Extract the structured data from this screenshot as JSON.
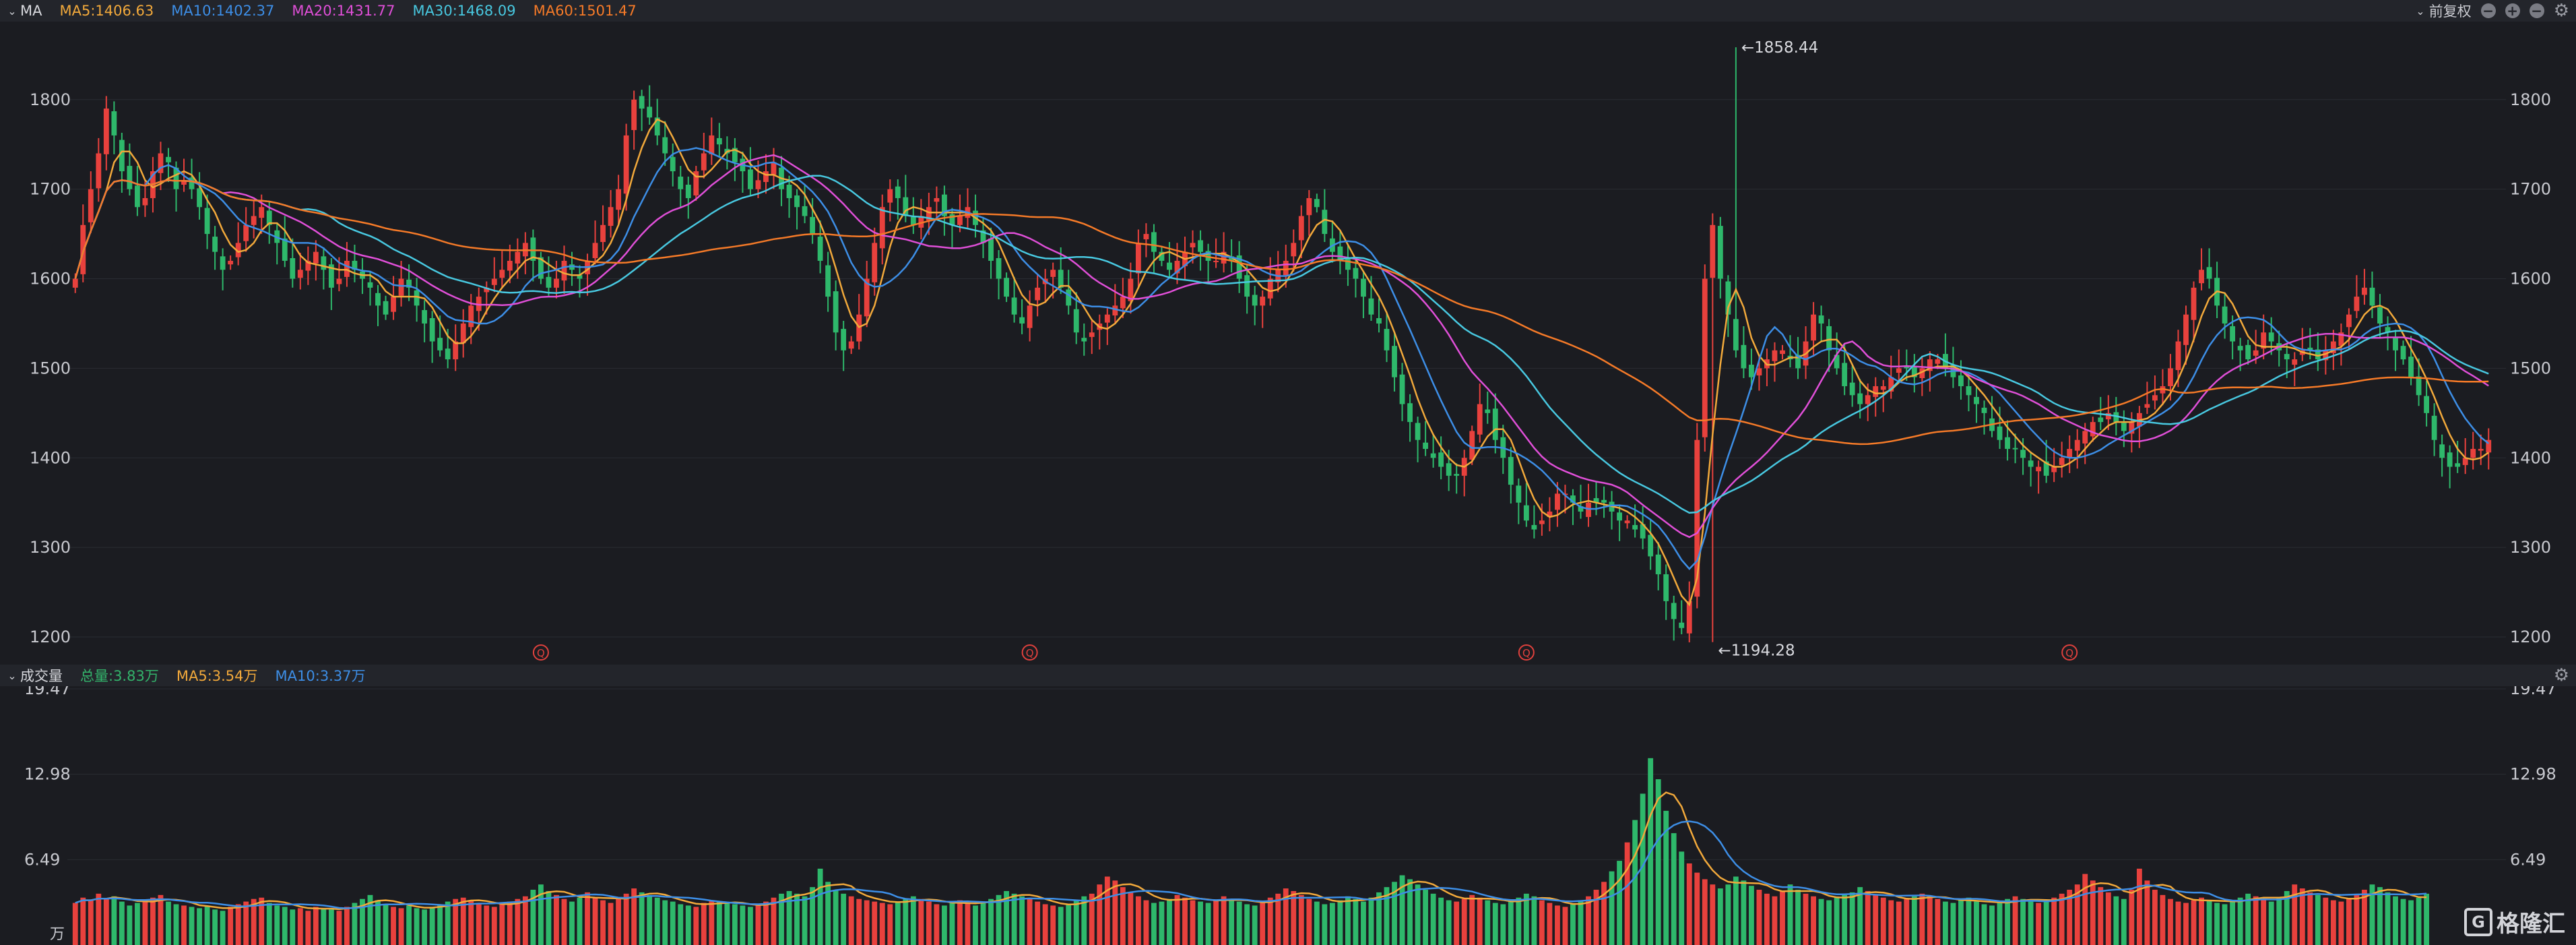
{
  "top_bar": {
    "indicator": "MA",
    "ma_readouts": [
      {
        "label": "MA5:1406.63",
        "color": "#f2a93b"
      },
      {
        "label": "MA10:1402.37",
        "color": "#3d8ee6"
      },
      {
        "label": "MA20:1431.77",
        "color": "#e04fd8"
      },
      {
        "label": "MA30:1468.09",
        "color": "#48c8e0"
      },
      {
        "label": "MA60:1501.47",
        "color": "#f57a28"
      }
    ],
    "adjust_label": "前复权"
  },
  "volume_bar": {
    "title": "成交量",
    "readouts": [
      {
        "label": "总量:3.83万",
        "color": "#33b46b"
      },
      {
        "label": "MA5:3.54万",
        "color": "#f2a93b"
      },
      {
        "label": "MA10:3.37万",
        "color": "#3d8ee6"
      }
    ]
  },
  "volume_unit": "万",
  "watermark": "格隆汇",
  "colors": {
    "up": "#e8413d",
    "down": "#2eb86b",
    "ma60": "#f57a28",
    "ma5": "#f2a93b",
    "ma10": "#3d8ee6",
    "ma20": "#e04fd8",
    "ma30": "#48c8e0"
  },
  "chart_data": {
    "type": "candlestick",
    "price_axis": {
      "ticks": [
        1200,
        1300,
        1400,
        1500,
        1600,
        1700,
        1800
      ],
      "labels": [
        "1200",
        "1300",
        "1400",
        "1500",
        "1600",
        "1700",
        "1800"
      ]
    },
    "price_annotations": {
      "high": {
        "value": 1858.44,
        "label": "←1858.44"
      },
      "low": {
        "value": 1194.28,
        "label": "←1194.28"
      }
    },
    "volume_axis": {
      "ticks": [
        6.49,
        12.98,
        19.47
      ],
      "labels": [
        "6.49",
        "12.98",
        "19.47"
      ],
      "unit": "万"
    },
    "event_markers": [
      {
        "index": 60,
        "label": "Q"
      },
      {
        "index": 123,
        "label": "Q"
      },
      {
        "index": 187,
        "label": "Q"
      },
      {
        "index": 257,
        "label": "Q"
      },
      {
        "index": 329,
        "label": "Q"
      }
    ],
    "close_series": [
      1600,
      1660,
      1700,
      1740,
      1790,
      1760,
      1720,
      1700,
      1680,
      1690,
      1720,
      1740,
      1730,
      1700,
      1710,
      1700,
      1680,
      1650,
      1630,
      1610,
      1620,
      1640,
      1660,
      1670,
      1680,
      1660,
      1640,
      1620,
      1600,
      1610,
      1620,
      1630,
      1610,
      1590,
      1600,
      1620,
      1610,
      1600,
      1590,
      1570,
      1560,
      1580,
      1600,
      1590,
      1570,
      1550,
      1530,
      1520,
      1510,
      1530,
      1550,
      1570,
      1580,
      1590,
      1600,
      1610,
      1620,
      1630,
      1640,
      1620,
      1600,
      1590,
      1600,
      1620,
      1610,
      1600,
      1620,
      1640,
      1660,
      1680,
      1700,
      1760,
      1800,
      1790,
      1780,
      1760,
      1740,
      1720,
      1700,
      1690,
      1720,
      1740,
      1760,
      1750,
      1740,
      1730,
      1720,
      1700,
      1710,
      1720,
      1730,
      1700,
      1690,
      1680,
      1670,
      1650,
      1620,
      1580,
      1540,
      1520,
      1530,
      1560,
      1600,
      1640,
      1680,
      1700,
      1690,
      1670,
      1660,
      1670,
      1680,
      1690,
      1670,
      1660,
      1670,
      1680,
      1660,
      1640,
      1620,
      1600,
      1580,
      1560,
      1550,
      1570,
      1590,
      1600,
      1610,
      1590,
      1570,
      1540,
      1530,
      1540,
      1550,
      1560,
      1570,
      1580,
      1600,
      1640,
      1650,
      1630,
      1620,
      1610,
      1620,
      1630,
      1640,
      1630,
      1620,
      1620,
      1630,
      1620,
      1600,
      1580,
      1570,
      1580,
      1600,
      1610,
      1620,
      1640,
      1670,
      1690,
      1680,
      1650,
      1630,
      1620,
      1610,
      1600,
      1580,
      1560,
      1550,
      1520,
      1490,
      1460,
      1440,
      1420,
      1410,
      1400,
      1390,
      1380,
      1380,
      1400,
      1430,
      1460,
      1450,
      1420,
      1400,
      1370,
      1350,
      1330,
      1320,
      1330,
      1340,
      1360,
      1360,
      1350,
      1340,
      1350,
      1350,
      1350,
      1340,
      1330,
      1330,
      1320,
      1310,
      1290,
      1270,
      1240,
      1220,
      1210,
      1240,
      1420,
      1600,
      1660,
      1600,
      1560,
      1520,
      1500,
      1490,
      1500,
      1510,
      1520,
      1520,
      1510,
      1500,
      1530,
      1560,
      1550,
      1520,
      1500,
      1480,
      1470,
      1460,
      1470,
      1480,
      1480,
      1490,
      1500,
      1500,
      1490,
      1500,
      1510,
      1510,
      1500,
      1490,
      1480,
      1470,
      1460,
      1450,
      1430,
      1420,
      1410,
      1410,
      1400,
      1390,
      1390,
      1380,
      1390,
      1400,
      1410,
      1420,
      1430,
      1440,
      1440,
      1450,
      1440,
      1430,
      1440,
      1450,
      1460,
      1470,
      1480,
      1500,
      1530,
      1560,
      1590,
      1610,
      1600,
      1570,
      1550,
      1530,
      1520,
      1510,
      1520,
      1540,
      1530,
      1520,
      1510,
      1510,
      1520,
      1520,
      1510,
      1520,
      1530,
      1540,
      1560,
      1580,
      1590,
      1570,
      1550,
      1540,
      1520,
      1510,
      1490,
      1470,
      1450,
      1420,
      1400,
      1390,
      1390,
      1400,
      1410,
      1410,
      1420
    ],
    "volume_series": [
      3.2,
      3.6,
      3.4,
      3.9,
      3.5,
      3.7,
      3.3,
      3.0,
      3.2,
      3.4,
      3.6,
      3.8,
      3.3,
      3.1,
      3.0,
      2.9,
      2.8,
      3.0,
      2.7,
      2.6,
      2.9,
      3.1,
      3.3,
      3.5,
      3.6,
      3.2,
      3.0,
      2.9,
      2.7,
      2.8,
      2.6,
      2.9,
      2.8,
      2.7,
      2.6,
      2.9,
      3.2,
      3.5,
      3.8,
      3.4,
      3.1,
      2.9,
      2.8,
      3.0,
      2.8,
      2.7,
      2.9,
      3.1,
      3.3,
      3.5,
      3.6,
      3.4,
      3.2,
      3.0,
      2.9,
      3.1,
      3.3,
      3.5,
      3.7,
      4.2,
      4.6,
      4.1,
      3.8,
      3.5,
      3.3,
      3.6,
      4.0,
      3.6,
      3.4,
      3.2,
      3.5,
      3.9,
      4.3,
      4.0,
      3.8,
      3.6,
      3.4,
      3.3,
      3.1,
      3.0,
      2.9,
      3.2,
      3.4,
      3.3,
      3.2,
      3.1,
      3.0,
      2.9,
      3.0,
      3.3,
      3.6,
      3.9,
      4.1,
      3.9,
      3.7,
      4.4,
      5.8,
      4.8,
      4.2,
      3.9,
      3.7,
      3.5,
      3.4,
      3.3,
      3.2,
      3.1,
      3.3,
      3.5,
      3.7,
      3.5,
      3.3,
      3.1,
      3.0,
      3.2,
      3.4,
      3.2,
      3.0,
      3.3,
      3.5,
      3.8,
      4.1,
      3.9,
      3.7,
      3.5,
      3.3,
      3.1,
      3.0,
      2.9,
      3.1,
      3.4,
      3.7,
      3.9,
      4.6,
      5.2,
      4.9,
      4.4,
      4.0,
      3.7,
      3.4,
      3.2,
      3.3,
      3.5,
      3.8,
      3.6,
      3.4,
      3.3,
      3.2,
      3.4,
      3.7,
      3.5,
      3.3,
      3.1,
      3.0,
      3.3,
      3.6,
      3.9,
      4.3,
      4.1,
      3.8,
      3.5,
      3.3,
      3.1,
      3.2,
      3.4,
      3.7,
      3.5,
      3.3,
      3.6,
      4.0,
      4.4,
      4.8,
      5.3,
      5.0,
      4.6,
      4.2,
      3.9,
      3.6,
      3.4,
      3.3,
      3.5,
      3.8,
      3.6,
      3.4,
      3.2,
      3.1,
      3.3,
      3.6,
      3.9,
      3.7,
      3.4,
      3.2,
      3.0,
      2.9,
      3.1,
      3.4,
      3.7,
      4.2,
      4.8,
      5.6,
      6.4,
      7.8,
      9.5,
      11.5,
      14.2,
      12.6,
      10.2,
      8.5,
      7.1,
      6.2,
      5.5,
      5.0,
      4.6,
      4.3,
      4.6,
      5.2,
      4.9,
      4.5,
      4.2,
      3.9,
      3.7,
      4.1,
      4.6,
      4.2,
      3.9,
      3.7,
      3.5,
      3.4,
      3.6,
      3.8,
      4.0,
      4.4,
      4.1,
      3.8,
      3.6,
      3.4,
      3.3,
      3.5,
      3.7,
      3.9,
      3.7,
      3.5,
      3.3,
      3.2,
      3.4,
      3.6,
      3.3,
      3.1,
      3.0,
      3.2,
      3.5,
      3.7,
      3.5,
      3.3,
      3.2,
      3.4,
      3.6,
      3.9,
      4.2,
      4.6,
      5.4,
      4.9,
      4.4,
      4.0,
      3.7,
      3.5,
      4.2,
      5.8,
      4.9,
      4.2,
      3.8,
      3.5,
      3.3,
      3.2,
      3.4,
      3.6,
      3.4,
      3.2,
      3.1,
      3.3,
      3.6,
      3.9,
      3.7,
      3.5,
      3.3,
      3.6,
      4.1,
      4.6,
      4.3,
      4.0,
      3.8,
      3.6,
      3.4,
      3.3,
      3.5,
      3.8,
      4.2,
      4.6,
      4.4,
      4.0,
      3.7,
      3.5,
      3.4,
      3.6,
      3.9
    ]
  }
}
